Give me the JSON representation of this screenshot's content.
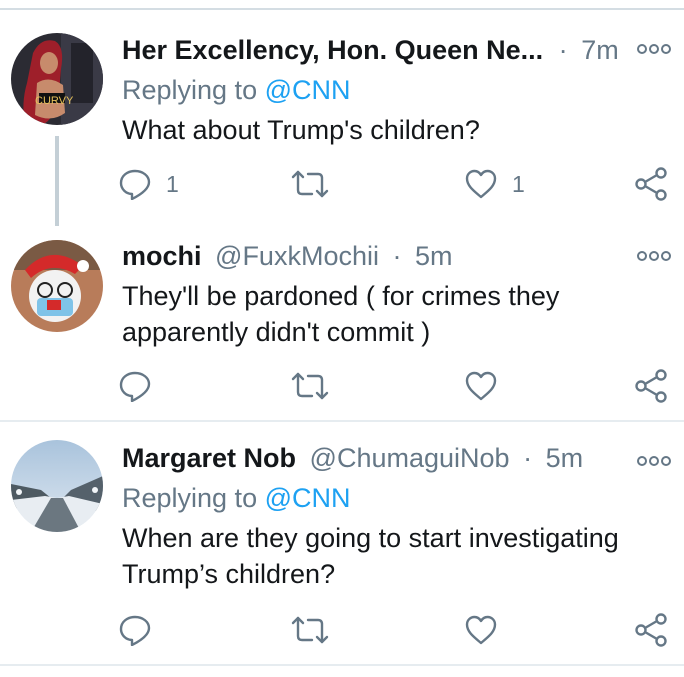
{
  "tweets": [
    {
      "name": "Her Excellency, Hon. Queen Ne...",
      "handle": "",
      "dot": "·",
      "time": "7m",
      "replying_label": "Replying to",
      "replying_mention": "@CNN",
      "text": "What about Trump's children?",
      "reply_count": "1",
      "retweet_count": "",
      "like_count": "1",
      "avatar_text": "CURVY"
    },
    {
      "name": "mochi",
      "handle": "@FuxkMochii",
      "dot": "·",
      "time": "5m",
      "text": "They'll be pardoned ( for crimes they apparently didn't commit )",
      "reply_count": "",
      "retweet_count": "",
      "like_count": ""
    },
    {
      "name": "Margaret Nob",
      "handle": "@ChumaguiNob",
      "dot": "·",
      "time": "5m",
      "replying_label": "Replying to",
      "replying_mention": "@CNN",
      "text": "When are they going  to start investigating Trump’s children?",
      "reply_count": "",
      "retweet_count": "",
      "like_count": ""
    }
  ],
  "icons": {
    "reply": "reply-icon",
    "retweet": "retweet-icon",
    "like": "like-icon",
    "share": "share-icon",
    "more": "more-icon"
  },
  "colors": {
    "text": "#14171a",
    "muted": "#657786",
    "link": "#1da1f2",
    "icon": "#657786",
    "divider": "#e6ecf0",
    "thread_line": "#c4cfd6"
  }
}
